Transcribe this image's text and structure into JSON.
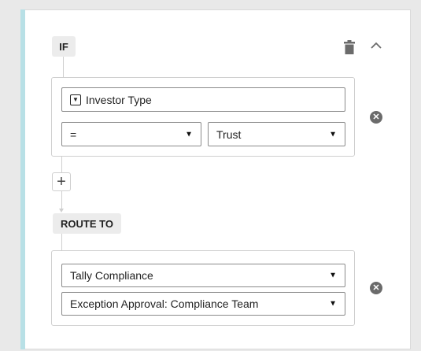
{
  "rule": {
    "if_label": "IF",
    "route_label": "ROUTE TO"
  },
  "condition": {
    "field_label": "Investor Type",
    "field_icon": "dropdown-field-icon",
    "operator": "=",
    "value": "Trust"
  },
  "route": {
    "team": "Tally Compliance",
    "approval": "Exception Approval: Compliance Team"
  },
  "icons": {
    "delete": "trash-icon",
    "collapse": "chevron-up-icon",
    "remove": "close-circle-icon",
    "add": "plus-icon",
    "dropdown": "caret-down-icon"
  },
  "colors": {
    "accent": "#b8e0e6",
    "tag_bg": "#ececec",
    "remove_icon": "#6b6b6b"
  }
}
